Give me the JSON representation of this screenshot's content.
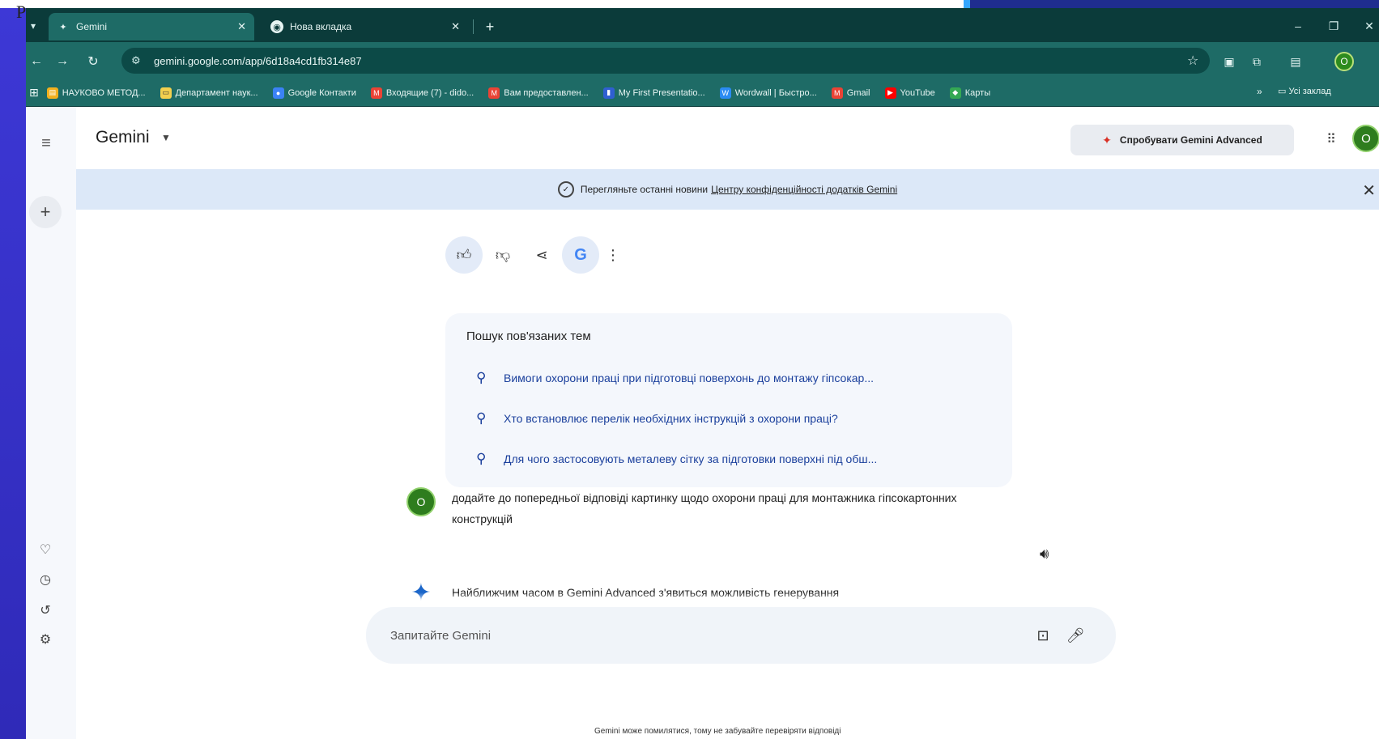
{
  "background": {
    "ghost_text": "Р"
  },
  "browser": {
    "tabs": [
      {
        "label": "Gemini",
        "icon": "gemini-spark-icon",
        "active": true,
        "close": "✕"
      },
      {
        "label": "Нова вкладка",
        "icon": "chrome-icon",
        "active": false,
        "close": "✕"
      }
    ],
    "new_tab": "+",
    "window_controls": {
      "minimize": "–",
      "restore": "❐",
      "close": "✕"
    },
    "url": "gemini.google.com/app/6d18a4cd1fb314e87",
    "bookmarks": [
      {
        "label": "НАУКОВО МЕТОД...",
        "icon": "folder-icon",
        "color": "#f2b01e"
      },
      {
        "label": "Департамент наук...",
        "icon": "doc-icon",
        "color": "#f2d04e"
      },
      {
        "label": "Google Контакти",
        "icon": "contacts-icon",
        "color": "#3b82f6"
      },
      {
        "label": "Входящие (7) - dido...",
        "icon": "gmail-icon",
        "color": "#ea4335"
      },
      {
        "label": "Вам предоставлен...",
        "icon": "gmail-icon",
        "color": "#ea4335"
      },
      {
        "label": "My First Presentatio...",
        "icon": "slides-icon",
        "color": "#2f5fd1"
      },
      {
        "label": "Wordwall | Быстро...",
        "icon": "wordwall-icon",
        "color": "#2a8bf2"
      },
      {
        "label": "Gmail",
        "icon": "gmail-icon",
        "color": "#ea4335"
      },
      {
        "label": "YouTube",
        "icon": "youtube-icon",
        "color": "#ff0000"
      },
      {
        "label": "Карты",
        "icon": "maps-icon",
        "color": "#34a853"
      }
    ],
    "bookmarks_more": "»",
    "all_bookmarks": "Усі заклад",
    "profile_initial": "О"
  },
  "app": {
    "brand": "Gemini",
    "advanced_button": "Спробувати Gemini Advanced",
    "avatar_initial": "О",
    "banner": {
      "text": "Перегляньте останні новини",
      "link": "Центру конфіденційності додатків Gemini"
    },
    "related": {
      "title": "Пошук пов'язаних тем",
      "items": [
        "Вимоги охорони праці при підготовці поверхонь до монтажу гіпсокар...",
        "Хто встановлює перелік необхідних інструкцій з охорони праці?",
        "Для чого застосовують металеву сітку за підготовки поверхні під обш..."
      ]
    },
    "user_message": "додайте до попередньої відповіді картинку щодо охорони праці для монтажника гіпсокартонних конструкцій",
    "model_message": "Найближчим часом в Gemini Advanced з'явиться можливість генерування",
    "input_placeholder": "Запитайте Gemini",
    "disclaimer": "Gemini може помилятися, тому не забувайте перевіряти відповіді"
  },
  "colors": {
    "tab_bar": "#0b3b3a",
    "toolbar": "#1e6b66",
    "banner": "#dce8f8",
    "link_blue": "#1a3f9c",
    "avatar_green": "#2e7d1e"
  }
}
